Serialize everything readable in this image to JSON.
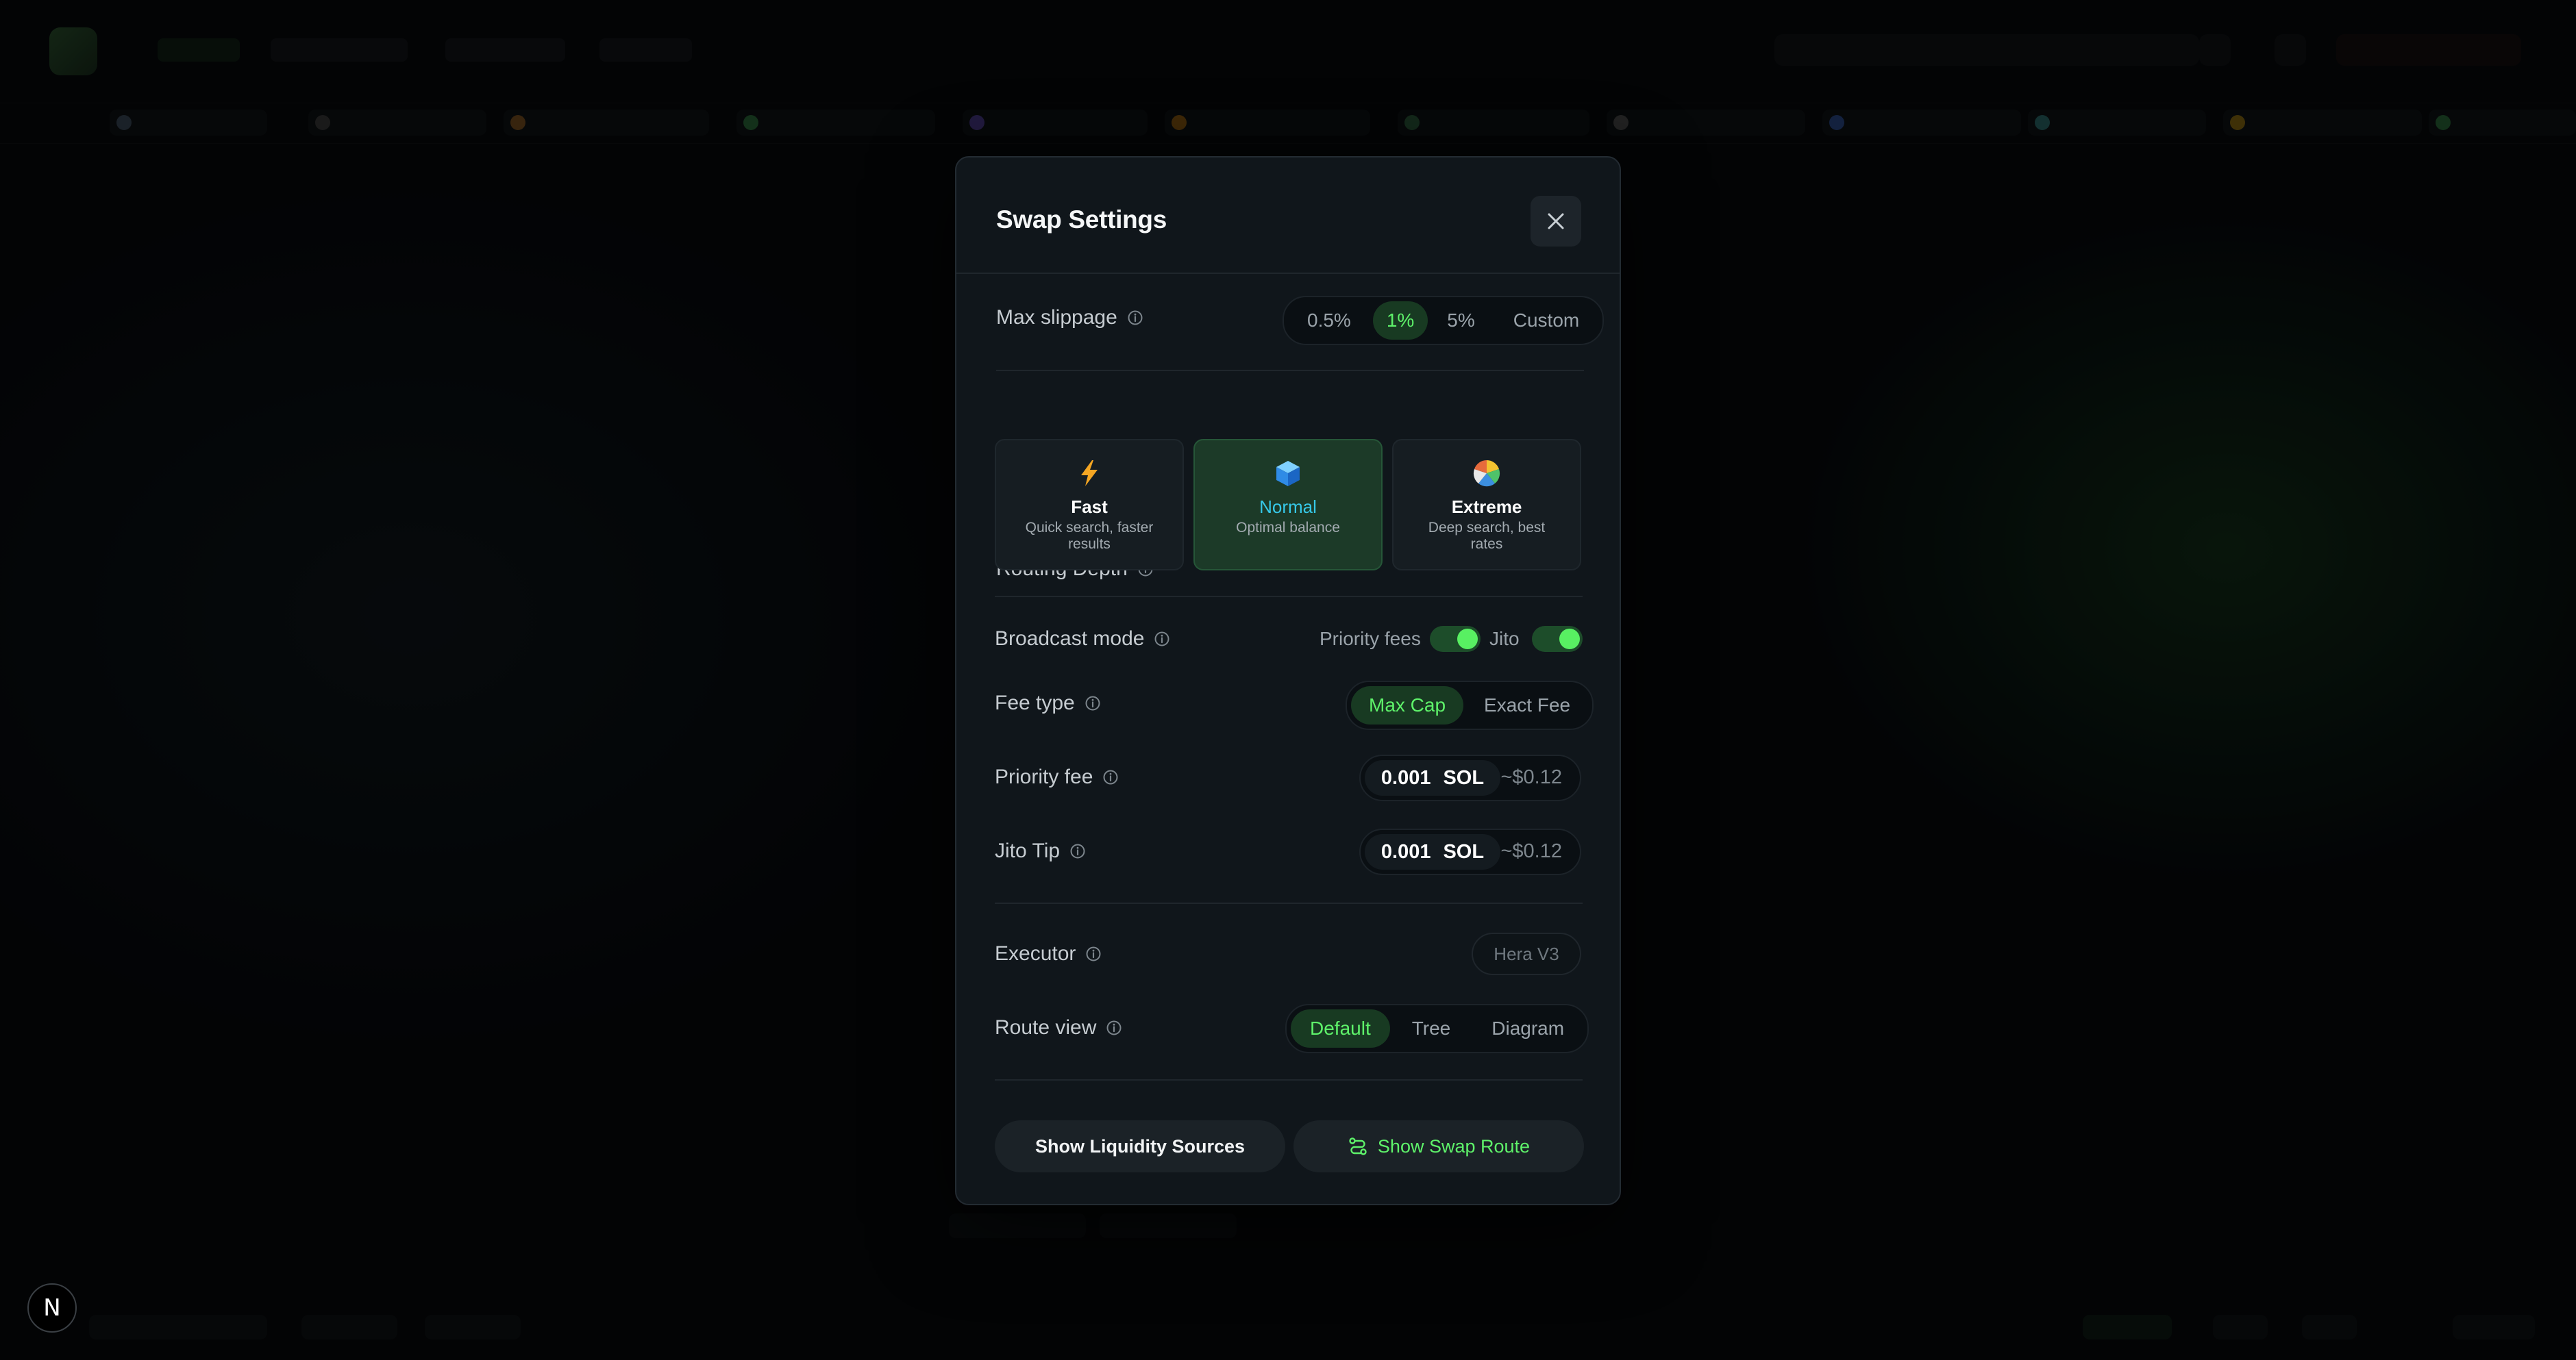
{
  "modal": {
    "title": "Swap Settings"
  },
  "max_slippage": {
    "label": "Max slippage",
    "options": [
      "0.5%",
      "1%",
      "5%",
      "Custom"
    ],
    "selected": "1%"
  },
  "routing_depth": {
    "label": "Routing Depth",
    "selected": "Normal",
    "options": [
      {
        "name": "Fast",
        "description": "Quick search, faster results",
        "icon": "lightning-icon"
      },
      {
        "name": "Normal",
        "description": "Optimal balance",
        "icon": "cube-icon"
      },
      {
        "name": "Extreme",
        "description": "Deep search, best rates",
        "icon": "pie-icon"
      }
    ]
  },
  "broadcast_mode": {
    "label": "Broadcast mode",
    "priority_fees_label": "Priority fees",
    "priority_fees_on": true,
    "jito_label": "Jito",
    "jito_on": true
  },
  "fee_type": {
    "label": "Fee type",
    "options": [
      "Max Cap",
      "Exact Fee"
    ],
    "selected": "Max Cap"
  },
  "priority_fee": {
    "label": "Priority fee",
    "value": "0.001",
    "unit": "SOL",
    "usd": "~$0.12"
  },
  "jito_tip": {
    "label": "Jito Tip",
    "value": "0.001",
    "unit": "SOL",
    "usd": "~$0.12"
  },
  "executor": {
    "label": "Executor",
    "value": "Hera V3"
  },
  "route_view": {
    "label": "Route view",
    "options": [
      "Default",
      "Tree",
      "Diagram"
    ],
    "selected": "Default"
  },
  "buttons": {
    "liquidity": "Show Liquidity Sources",
    "swap_route": "Show Swap Route"
  },
  "badge": {
    "letter": "N"
  },
  "colors": {
    "accent_green": "#5ef26a",
    "accent_cyan": "#36c8e8",
    "modal_bg": "#10161b"
  }
}
